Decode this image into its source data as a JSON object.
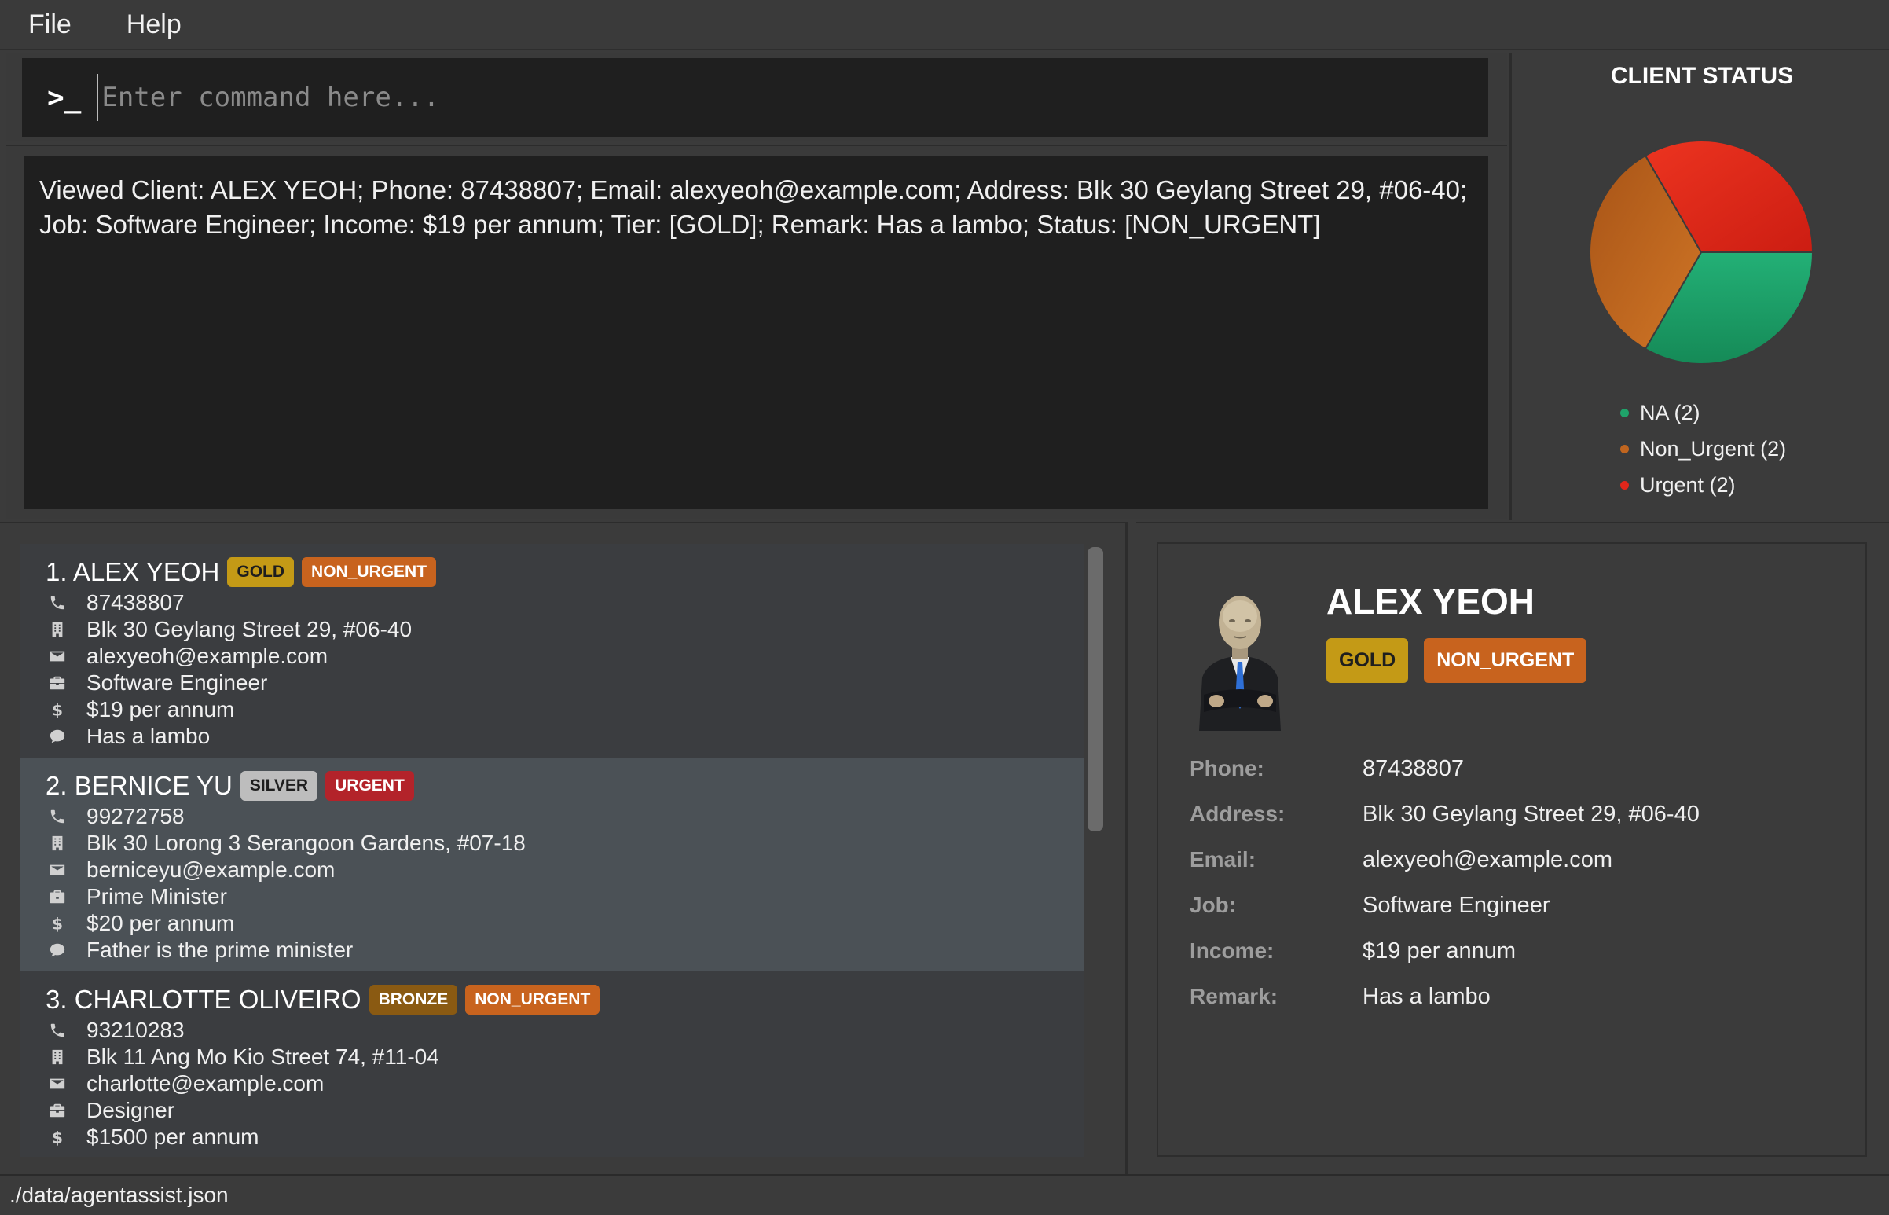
{
  "menu": {
    "file": "File",
    "help": "Help"
  },
  "command": {
    "prompt_icon": "terminal-prompt-icon",
    "placeholder": "Enter command here..."
  },
  "result": {
    "line1": "Viewed Client: ALEX YEOH; Phone: 87438807; Email: alexyeoh@example.com; Address: Blk 30 Geylang Street 29, #06-40;",
    "line2": "Job: Software Engineer; Income: $19 per annum; Tier: [GOLD]; Remark: Has a lambo; Status: [NON_URGENT]"
  },
  "status": {
    "title": "CLIENT STATUS",
    "legend": [
      {
        "label": "NA (2)",
        "color": "#1fa36a"
      },
      {
        "label": "Non_Urgent (2)",
        "color": "#c0651f"
      },
      {
        "label": "Urgent (2)",
        "color": "#e0261b"
      }
    ]
  },
  "chart_data": {
    "type": "pie",
    "title": "CLIENT STATUS",
    "categories": [
      "NA",
      "Non_Urgent",
      "Urgent"
    ],
    "values": [
      2,
      2,
      2
    ],
    "colors": [
      "#1fa36a",
      "#c0651f",
      "#e0261b"
    ]
  },
  "clients": [
    {
      "header": "1. ALEX YEOH",
      "tier": "GOLD",
      "status": "NON_URGENT",
      "phone": "87438807",
      "address": "Blk 30 Geylang Street 29, #06-40",
      "email": "alexyeoh@example.com",
      "job": "Software Engineer",
      "income": "$19 per annum",
      "remark": "Has a lambo"
    },
    {
      "header": "2. BERNICE YU",
      "tier": "SILVER",
      "status": "URGENT",
      "phone": "99272758",
      "address": "Blk 30 Lorong 3 Serangoon Gardens, #07-18",
      "email": "berniceyu@example.com",
      "job": "Prime Minister",
      "income": "$20 per annum",
      "remark": "Father is the prime minister"
    },
    {
      "header": "3. CHARLOTTE OLIVEIRO",
      "tier": "BRONZE",
      "status": "NON_URGENT",
      "phone": "93210283",
      "address": "Blk 11 Ang Mo Kio Street 74, #11-04",
      "email": "charlotte@example.com",
      "job": "Designer",
      "income": "$1500 per annum"
    }
  ],
  "detail": {
    "name": "ALEX YEOH",
    "tier": "GOLD",
    "status": "NON_URGENT",
    "labels": {
      "phone": "Phone:",
      "address": "Address:",
      "email": "Email:",
      "job": "Job:",
      "income": "Income:",
      "remark": "Remark:"
    },
    "values": {
      "phone": "87438807",
      "address": "Blk 30 Geylang Street 29, #06-40",
      "email": "alexyeoh@example.com",
      "job": "Software Engineer",
      "income": "$19 per annum",
      "remark": "Has a lambo"
    }
  },
  "statusbar": {
    "path": "./data/agentassist.json"
  }
}
